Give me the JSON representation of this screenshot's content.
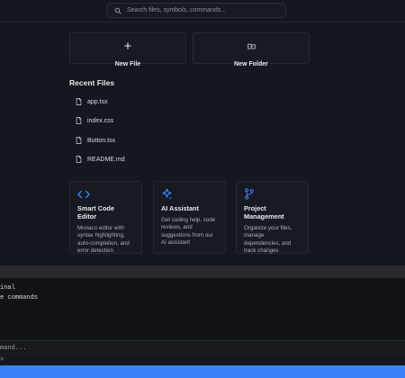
{
  "search": {
    "placeholder": "Search files, symbols, commands..."
  },
  "actions": [
    {
      "label": "New File",
      "icon": "plus-icon"
    },
    {
      "label": "New Folder",
      "icon": "folder-plus-icon"
    }
  ],
  "recent": {
    "title": "Recent Files",
    "files": [
      "app.tsx",
      "index.css",
      "Button.tsx",
      "README.md"
    ]
  },
  "features": [
    {
      "title": "Smart Code Editor",
      "description": "Monaco editor with syntax highlighting, auto-completion, and error detection",
      "icon": "code-brackets-icon",
      "color": "#3b82f6"
    },
    {
      "title": "AI Assistant",
      "description": "Get coding help, code reviews, and suggestions from our AI assistant",
      "icon": "sparkle-icon",
      "color": "#3b82f6"
    },
    {
      "title": "Project Management",
      "description": "Organize your files, manage dependencies, and track changes",
      "icon": "git-branch-icon",
      "color": "#3b82f6"
    }
  ],
  "terminal": {
    "line1": "inal",
    "line2": "e commands"
  },
  "command_input": {
    "text": "mand..."
  },
  "cursor": ">",
  "colors": {
    "background": "#14171d",
    "accent": "#3b82f6",
    "panel": "#171a20"
  }
}
